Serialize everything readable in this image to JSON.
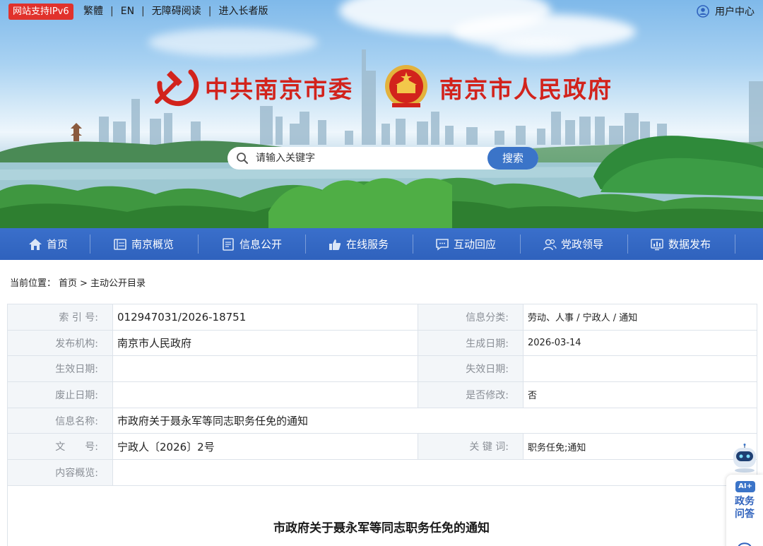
{
  "topbar": {
    "ipv6_badge": "网站支持IPv6",
    "links": [
      "繁體",
      "EN",
      "无障碍阅读",
      "进入长者版"
    ],
    "separator": "|",
    "user_center": "用户中心"
  },
  "banner": {
    "party_title": "中共南京市委",
    "gov_title": "南京市人民政府",
    "search_placeholder": "请输入关键字",
    "search_button": "搜索"
  },
  "nav": {
    "items": [
      {
        "label": "首页",
        "icon": "home-icon"
      },
      {
        "label": "南京概览",
        "icon": "overview-icon"
      },
      {
        "label": "信息公开",
        "icon": "document-icon"
      },
      {
        "label": "在线服务",
        "icon": "thumbs-up-icon"
      },
      {
        "label": "互动回应",
        "icon": "chat-icon"
      },
      {
        "label": "党政领导",
        "icon": "people-icon"
      },
      {
        "label": "数据发布",
        "icon": "chart-icon"
      }
    ]
  },
  "breadcrumb": {
    "prefix": "当前位置：",
    "home": "首页",
    "arrow": ">",
    "current": "主动公开目录"
  },
  "info": {
    "index_label": "索 引 号:",
    "index_value": "012947031/2026-18751",
    "category_label": "信息分类:",
    "category_value": "劳动、人事 / 宁政人 / 通知",
    "publisher_label": "发布机构:",
    "publisher_value": "南京市人民政府",
    "created_label": "生成日期:",
    "created_value": "2026-03-14",
    "effective_label": "生效日期:",
    "effective_value": "",
    "expire_label": "失效日期:",
    "expire_value": "",
    "abolish_label": "废止日期:",
    "abolish_value": "",
    "modified_label": "是否修改:",
    "modified_value": "否",
    "name_label": "信息名称:",
    "name_value": "市政府关于聂永军等同志职务任免的通知",
    "docno_label": "文　　号:",
    "docno_value": "宁政人〔2026〕2号",
    "keywords_label": "关 键 词:",
    "keywords_value": "职务任免;通知",
    "summary_label": "内容概览:",
    "summary_value": ""
  },
  "document": {
    "title": "市政府关于聂永军等同志职务任免的通知"
  },
  "ai_widget": {
    "badge": "AI+",
    "line1": "政务",
    "line2": "问答"
  },
  "colors": {
    "brand_red": "#d2231c",
    "nav_blue": "#2f62bd",
    "button_blue": "#3b74c8"
  }
}
